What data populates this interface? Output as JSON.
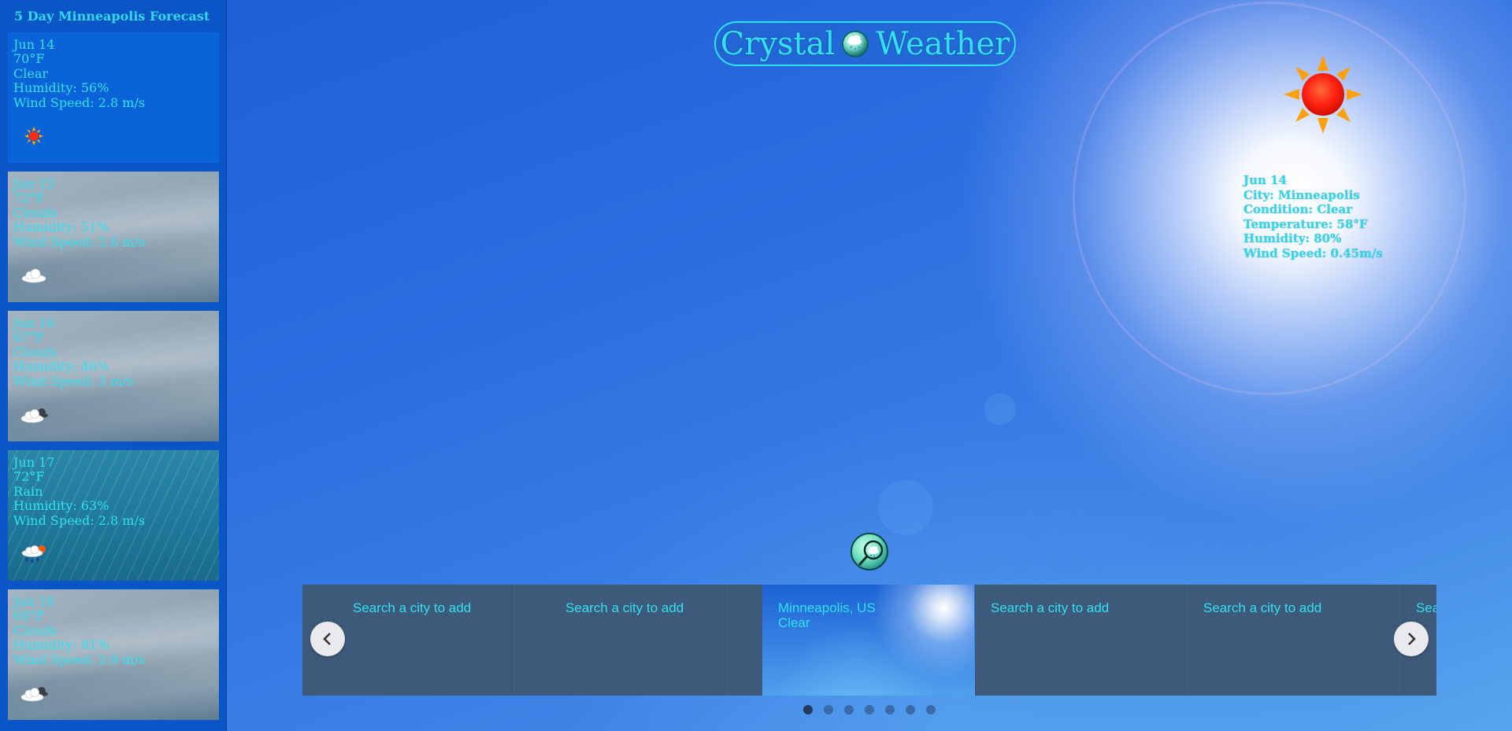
{
  "sidebar": {
    "title": "5 Day Minneapolis Forecast",
    "days": [
      {
        "date": "Jun 14",
        "temp": "70°F",
        "condition": "Clear",
        "humidity": "Humidity: 56%",
        "wind": "Wind Speed: 2.8 m/s",
        "icon": "sun-icon"
      },
      {
        "date": "Jun 15",
        "temp": "72°F",
        "condition": "Clouds",
        "humidity": "Humidity: 51%",
        "wind": "Wind Speed: 2.6 m/s",
        "icon": "cloud-icon"
      },
      {
        "date": "Jun 16",
        "temp": "67°F",
        "condition": "Clouds",
        "humidity": "Humidity: 46%",
        "wind": "Wind Speed: 3 m/s",
        "icon": "broken-clouds-icon"
      },
      {
        "date": "Jun 17",
        "temp": "72°F",
        "condition": "Rain",
        "humidity": "Humidity: 63%",
        "wind": "Wind Speed: 2.8 m/s",
        "icon": "rain-icon"
      },
      {
        "date": "Jun 18",
        "temp": "69°F",
        "condition": "Clouds",
        "humidity": "Humidity: 81%",
        "wind": "Wind Speed: 2.9 m/s",
        "icon": "broken-clouds-icon"
      }
    ]
  },
  "header": {
    "title_left": "Crystal",
    "title_right": "Weather",
    "logo_icon": "crystal-ball-icon"
  },
  "current": {
    "date": "Jun 14",
    "city": "City: Minneapolis",
    "condition": "Condition: Clear",
    "temperature": "Temperature: 58°F",
    "humidity": "Humidity: 80%",
    "wind": "Wind Speed: 0.45m/s",
    "icon": "sun-icon"
  },
  "search": {
    "icon": "magnifier-icon"
  },
  "carousel": {
    "slides": [
      {
        "line1": "Search a city to add",
        "line2": ""
      },
      {
        "line1": "Search a city to add",
        "line2": ""
      },
      {
        "line1": "Minneapolis, US",
        "line2": "Clear"
      },
      {
        "line1": "Search a city to add",
        "line2": ""
      },
      {
        "line1": "Search a city to add",
        "line2": ""
      },
      {
        "line1": "Search a city to add",
        "line2": ""
      }
    ],
    "active_index": 2,
    "dot_count": 7,
    "active_dot": 0
  },
  "colors": {
    "accent_text": "#33e0f0",
    "background": "#2b6ee0",
    "carousel_bg": "#3d5a7a"
  }
}
